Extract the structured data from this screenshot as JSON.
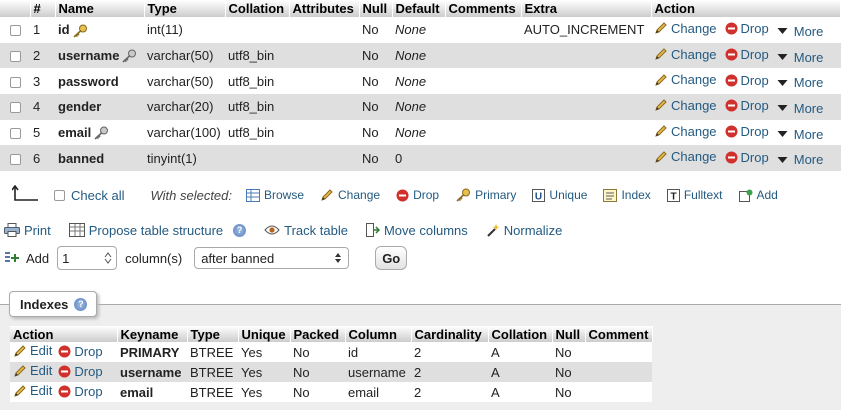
{
  "structure": {
    "headers": [
      "#",
      "Name",
      "Type",
      "Collation",
      "Attributes",
      "Null",
      "Default",
      "Comments",
      "Extra",
      "Action"
    ],
    "action_labels": {
      "change": "Change",
      "drop": "Drop",
      "more": "More"
    },
    "rows": [
      {
        "num": "1",
        "name": "id",
        "icon": "primary-key-icon",
        "type": "int(11)",
        "collation": "",
        "attributes": "",
        "null": "No",
        "default": "None",
        "comments": "",
        "extra": "AUTO_INCREMENT"
      },
      {
        "num": "2",
        "name": "username",
        "icon": "unique-key-icon",
        "type": "varchar(50)",
        "collation": "utf8_bin",
        "attributes": "",
        "null": "No",
        "default": "None",
        "comments": "",
        "extra": ""
      },
      {
        "num": "3",
        "name": "password",
        "icon": "",
        "type": "varchar(50)",
        "collation": "utf8_bin",
        "attributes": "",
        "null": "No",
        "default": "None",
        "comments": "",
        "extra": ""
      },
      {
        "num": "4",
        "name": "gender",
        "icon": "",
        "type": "varchar(20)",
        "collation": "utf8_bin",
        "attributes": "",
        "null": "No",
        "default": "None",
        "comments": "",
        "extra": ""
      },
      {
        "num": "5",
        "name": "email",
        "icon": "unique-key-icon",
        "type": "varchar(100)",
        "collation": "utf8_bin",
        "attributes": "",
        "null": "No",
        "default": "None",
        "comments": "",
        "extra": ""
      },
      {
        "num": "6",
        "name": "banned",
        "icon": "",
        "type": "tinyint(1)",
        "collation": "",
        "attributes": "",
        "null": "No",
        "default": "0",
        "comments": "",
        "extra": ""
      }
    ]
  },
  "checkbar": {
    "check_all": "Check all",
    "with_selected": "With selected:",
    "browse": "Browse",
    "change": "Change",
    "drop": "Drop",
    "primary": "Primary",
    "unique": "Unique",
    "index": "Index",
    "fulltext": "Fulltext",
    "add": "Add"
  },
  "actions": {
    "print": "Print",
    "propose": "Propose table structure",
    "track": "Track table",
    "move": "Move columns",
    "normalize": "Normalize"
  },
  "add_columns": {
    "add_label": "Add",
    "count": "1",
    "columns_label": "column(s)",
    "position": "after banned",
    "go": "Go"
  },
  "indexes": {
    "legend": "Indexes",
    "headers": [
      "Action",
      "Keyname",
      "Type",
      "Unique",
      "Packed",
      "Column",
      "Cardinality",
      "Collation",
      "Null",
      "Comment"
    ],
    "edit_label": "Edit",
    "drop_label": "Drop",
    "rows": [
      {
        "keyname": "PRIMARY",
        "type": "BTREE",
        "unique": "Yes",
        "packed": "No",
        "column": "id",
        "cardinality": "2",
        "collation": "A",
        "null": "No",
        "comment": ""
      },
      {
        "keyname": "username",
        "type": "BTREE",
        "unique": "Yes",
        "packed": "No",
        "column": "username",
        "cardinality": "2",
        "collation": "A",
        "null": "No",
        "comment": ""
      },
      {
        "keyname": "email",
        "type": "BTREE",
        "unique": "Yes",
        "packed": "No",
        "column": "email",
        "cardinality": "2",
        "collation": "A",
        "null": "No",
        "comment": ""
      }
    ]
  },
  "colors": {
    "link": "#235a81",
    "row_alt": "#dfdfdf",
    "drop_red": "#d0312d"
  }
}
